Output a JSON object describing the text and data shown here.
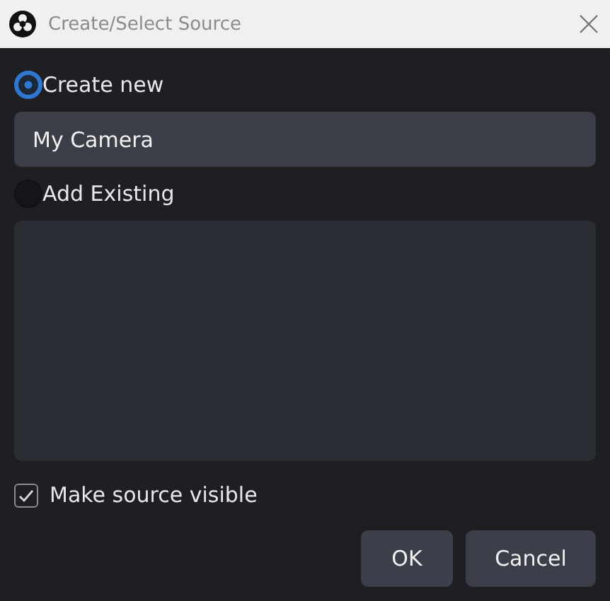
{
  "window": {
    "title": "Create/Select Source"
  },
  "options": [
    {
      "label": "Create new",
      "selected": true
    },
    {
      "label": "Add Existing",
      "selected": false
    }
  ],
  "name_field": {
    "value": "My Camera"
  },
  "visible_checkbox": {
    "label": "Make source visible",
    "checked": true
  },
  "buttons": [
    "OK",
    "Cancel"
  ]
}
